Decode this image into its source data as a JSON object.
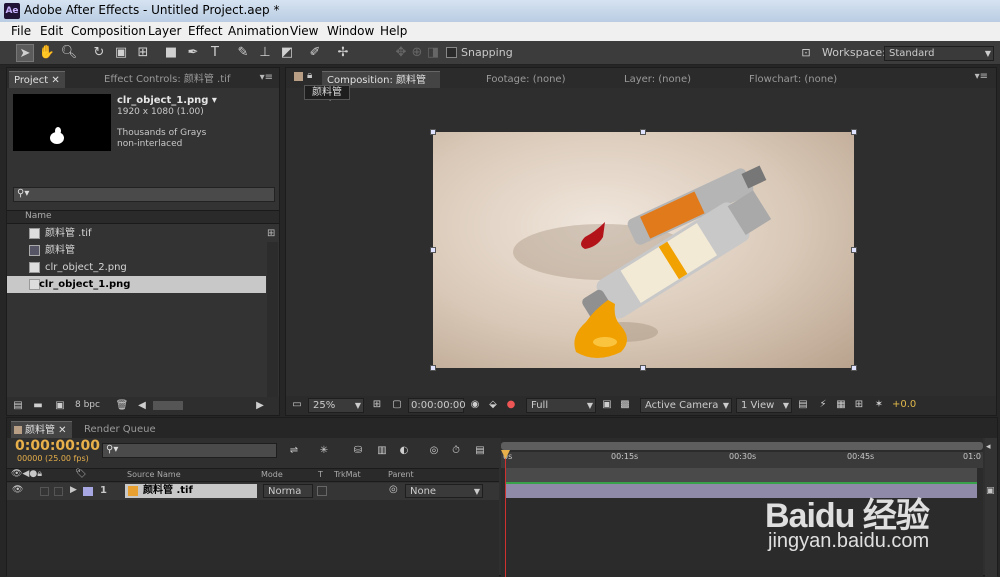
{
  "window": {
    "title": "Adobe After Effects - Untitled Project.aep *",
    "logo": "Ae"
  },
  "menu": [
    "File",
    "Edit",
    "Composition",
    "Layer",
    "Effect",
    "Animation",
    "View",
    "Window",
    "Help"
  ],
  "toolbar": {
    "snapping_label": "Snapping",
    "workspace_label": "Workspace:",
    "workspace_value": "Standard"
  },
  "project_panel": {
    "tabs": [
      "Project",
      "Effect Controls: 颜料管 .tif"
    ],
    "preview": {
      "name": "clr_object_1.png ▾",
      "dims": "1920 x 1080 (1.00)",
      "color": "Thousands of Grays",
      "interlace": "non-interlaced"
    },
    "search_placeholder": "",
    "column_name": "Name",
    "items": [
      {
        "label": "颜料管 .tif",
        "icon": "image-file-icon",
        "selected": false
      },
      {
        "label": "颜料管",
        "icon": "composition-icon",
        "selected": false
      },
      {
        "label": "clr_object_2.png",
        "icon": "image-file-icon",
        "selected": false
      },
      {
        "label": "clr_object_1.png",
        "icon": "image-file-icon",
        "selected": true
      }
    ],
    "bpc": "8 bpc"
  },
  "viewer": {
    "tabs": [
      "Composition: 颜料管",
      "Footage: (none)",
      "Layer: (none)",
      "Flowchart: (none)"
    ],
    "comp_crumb": "颜料管",
    "zoom": "25%",
    "timecode": "0:00:00:00",
    "resolution": "Full",
    "camera": "Active Camera",
    "views": "1 View",
    "exposure": "+0.0"
  },
  "timeline": {
    "tabs": [
      "颜料管",
      "Render Queue"
    ],
    "timecode": "0:00:00:00",
    "frame_info": "00000 (25.00 fps)",
    "columns": [
      "Source Name",
      "Mode",
      "T",
      "TrkMat",
      "Parent"
    ],
    "ruler": [
      "0s",
      "00:15s",
      "00:30s",
      "00:45s",
      "01:0"
    ],
    "layers": [
      {
        "num": "1",
        "name": "颜料管 .tif",
        "mode": "Norma",
        "parent": "None"
      }
    ]
  },
  "watermark": {
    "brand": "Baidu 经验",
    "url": "jingyan.baidu.com"
  }
}
